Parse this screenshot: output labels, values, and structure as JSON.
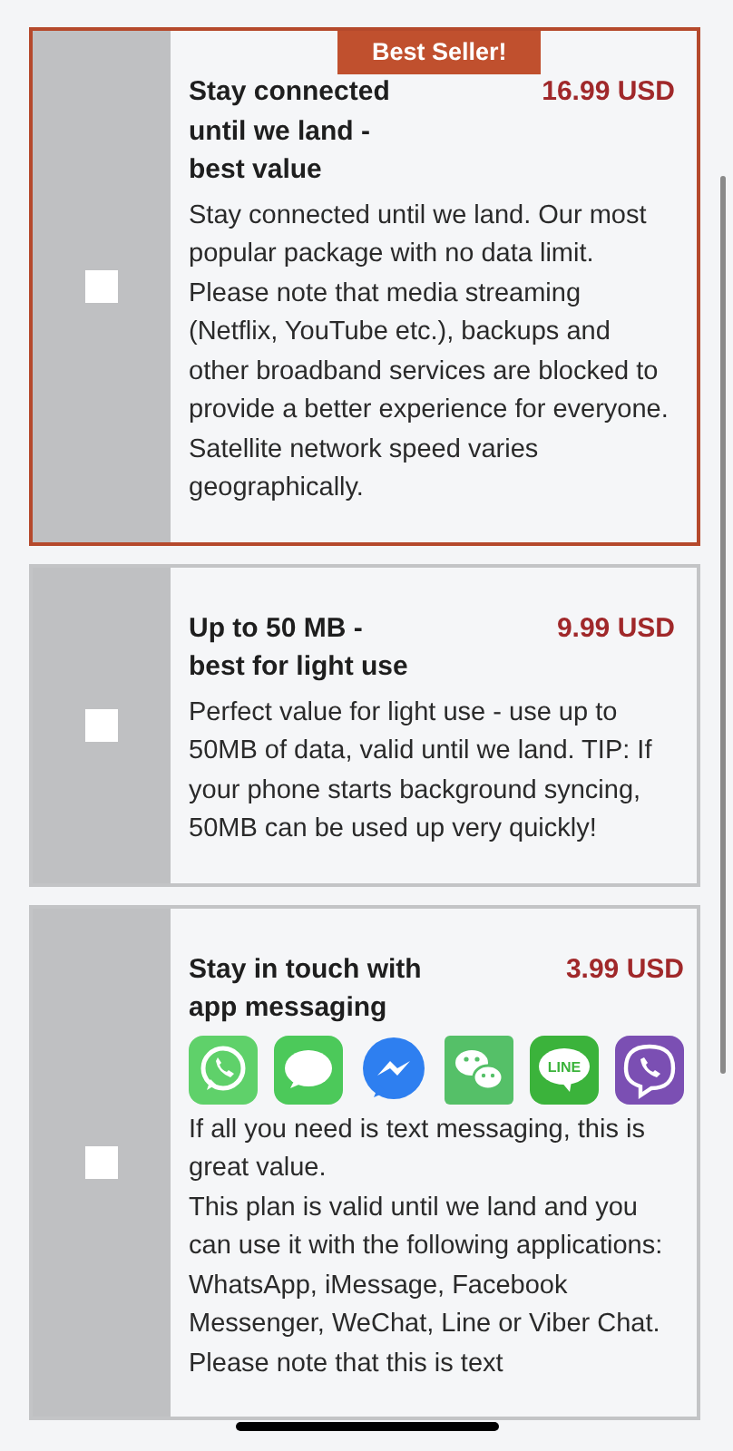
{
  "plans": [
    {
      "title": "Stay connected until we land - best value",
      "price": "16.99 USD",
      "badge": "Best Seller!",
      "highlighted": true,
      "checked": false,
      "description": [
        "Stay connected until we land. Our most popular package with no data limit. Please note that media streaming (Netflix, YouTube etc.), backups and other broadband services are blocked to provide a better experience for everyone. Satellite network speed varies geographically."
      ]
    },
    {
      "title": "Up to 50 MB - best for light use",
      "price": "9.99 USD",
      "highlighted": false,
      "checked": false,
      "description": [
        "Perfect value for light use - use up to 50MB of data, valid until we land. TIP: If your phone starts background syncing, 50MB can be used up very quickly!"
      ]
    },
    {
      "title": "Stay in touch with app messaging",
      "price": "3.99 USD",
      "highlighted": false,
      "checked": false,
      "apps": [
        {
          "kind": "whatsapp"
        },
        {
          "kind": "imessage"
        },
        {
          "kind": "messenger"
        },
        {
          "kind": "wechat"
        },
        {
          "kind": "line",
          "label": "LINE"
        },
        {
          "kind": "viber"
        }
      ],
      "description": [
        "If all you need is text messaging, this is great value.",
        "This plan is valid until we land and you can use it with the following applications: WhatsApp, iMessage, Facebook Messenger, WeChat, Line or Viber Chat. Please note that this is text"
      ]
    }
  ]
}
